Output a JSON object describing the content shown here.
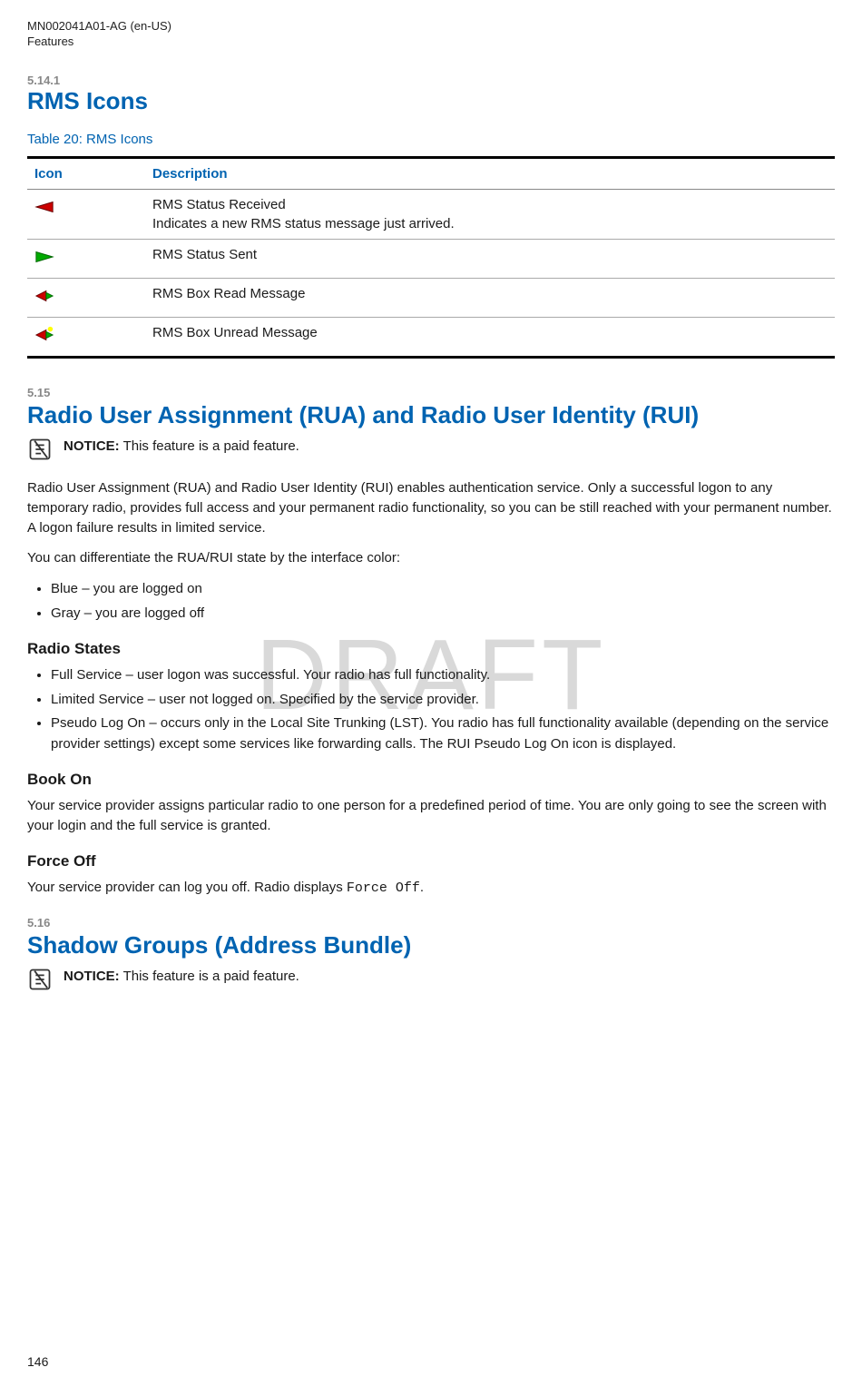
{
  "header": {
    "doc_id": "MN002041A01-AG (en-US)",
    "section": "Features"
  },
  "section_5_14_1": {
    "num": "5.14.1",
    "title": "RMS Icons",
    "table_caption": "Table 20: RMS Icons",
    "col_icon": "Icon",
    "col_desc": "Description",
    "rows": [
      {
        "icon_name": "rms-status-received-icon",
        "title": "RMS Status Received",
        "detail": "Indicates a new RMS status message just arrived."
      },
      {
        "icon_name": "rms-status-sent-icon",
        "title": "RMS Status Sent",
        "detail": ""
      },
      {
        "icon_name": "rms-box-read-icon",
        "title": "RMS Box Read Message",
        "detail": ""
      },
      {
        "icon_name": "rms-box-unread-icon",
        "title": "RMS Box Unread Message",
        "detail": ""
      }
    ]
  },
  "section_5_15": {
    "num": "5.15",
    "title": "Radio User Assignment (RUA) and Radio User Identity (RUI)",
    "notice_label": "NOTICE:",
    "notice_text": " This feature is a paid feature.",
    "para1": "Radio User Assignment (RUA) and Radio User Identity (RUI) enables authentication service. Only a successful logon to any temporary radio, provides full access and your permanent radio functionality, so you can be still reached with your permanent number. A logon failure results in limited service.",
    "para2": "You can differentiate the RUA/RUI state by the interface color:",
    "color_bullets": [
      "Blue – you are logged on",
      "Gray – you are logged off"
    ],
    "radio_states_head": "Radio States",
    "radio_states": [
      "Full Service – user logon was successful. Your radio has full functionality.",
      "Limited Service – user not logged on. Specified by the service provider.",
      "Pseudo Log On – occurs only in the Local Site Trunking (LST). You radio has full functionality available (depending on the service provider settings) except some services like forwarding calls. The RUI Pseudo Log On icon is displayed."
    ],
    "book_on_head": "Book On",
    "book_on_text": "Your service provider assigns particular radio to one person for a predefined period of time. You are only going to see the screen with your login and the full service is granted.",
    "force_off_head": "Force Off",
    "force_off_text_pre": "Your service provider can log you off. Radio displays ",
    "force_off_code": "Force Off",
    "force_off_text_post": "."
  },
  "section_5_16": {
    "num": "5.16",
    "title": "Shadow Groups (Address Bundle)",
    "notice_label": "NOTICE:",
    "notice_text": " This feature is a paid feature."
  },
  "page_number": "146",
  "watermark": "DRAFT"
}
